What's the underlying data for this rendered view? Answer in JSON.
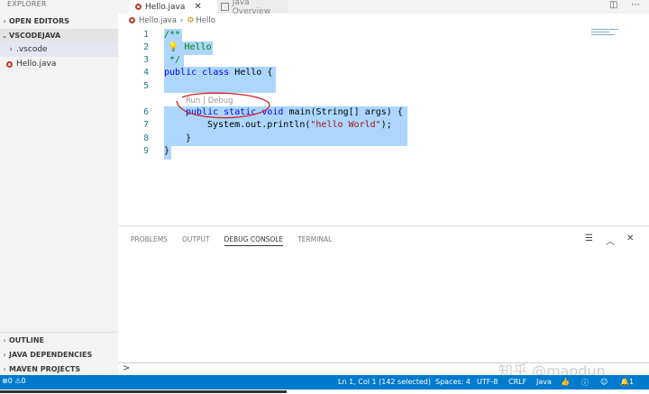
{
  "sidebar": {
    "title": "EXPLORER",
    "open_editors": "OPEN EDITORS",
    "folder": "VSCODEJAVA",
    "items": [
      {
        "label": ".vscode",
        "type": "folder"
      },
      {
        "label": "Hello.java",
        "type": "java"
      }
    ],
    "bottom_sections": [
      "OUTLINE",
      "JAVA DEPENDENCIES",
      "MAVEN PROJECTS"
    ]
  },
  "tabs": [
    {
      "label": "Hello.java",
      "active": true
    },
    {
      "label": "Java Overview",
      "active": false
    }
  ],
  "breadcrumb": {
    "file": "Hello.java",
    "symbol": "Hello"
  },
  "editor": {
    "line_numbers": [
      "1",
      "2",
      "3",
      "4",
      "5",
      "6",
      "7",
      "8",
      "9"
    ],
    "codelens": "Run | Debug",
    "lines": {
      "l1": "/**",
      "l2": "Hello",
      "l3": " */",
      "l4_kw1": "public",
      "l4_kw2": "class",
      "l4_rest": "Hello {",
      "l6_kw1": "public",
      "l6_kw2": "static",
      "l6_kw3": "void",
      "l6_rest": "main(String[] args) {",
      "l7_pre": "System.out.println(",
      "l7_str": "\"hello World\"",
      "l7_post": ");",
      "l8": "}",
      "l9": "}"
    }
  },
  "panel": {
    "tabs": [
      "PROBLEMS",
      "OUTPUT",
      "DEBUG CONSOLE",
      "TERMINAL"
    ],
    "active_tab": "DEBUG CONSOLE",
    "prompt": ">"
  },
  "statusbar": {
    "errors": "0",
    "warnings": "0",
    "position": "Ln 1, Col 1 (142 selected)",
    "spaces": "Spaces: 4",
    "encoding": "UTF-8",
    "eol": "CRLF",
    "language": "Java",
    "notifications": "1"
  },
  "watermark": "知乎 @maodun",
  "colors": {
    "statusbar": "#007acc",
    "selection": "#add6ff",
    "keyword": "#0000ff",
    "comment": "#008000",
    "string": "#a31515"
  }
}
